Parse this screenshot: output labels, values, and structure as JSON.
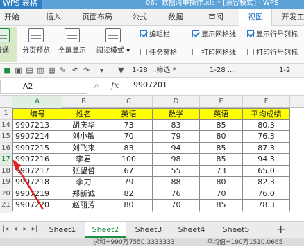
{
  "titlebar": {
    "app_name": "WPS 表格",
    "doc_title": "06：数据清单操作.xls * [兼容模式] - WPS"
  },
  "tabs": [
    {
      "label": "开始"
    },
    {
      "label": "插入"
    },
    {
      "label": "页面布局"
    },
    {
      "label": "公式"
    },
    {
      "label": "数据"
    },
    {
      "label": "审阅"
    },
    {
      "label": "视图"
    },
    {
      "label": "开发工"
    }
  ],
  "active_tab": "视图",
  "ribbon": {
    "buttons": [
      {
        "label": "普通",
        "icon": "normal-view-icon",
        "selected": true
      },
      {
        "label": "分页预览",
        "icon": "page-break-preview-icon",
        "selected": false
      },
      {
        "label": "全屏显示",
        "icon": "fullscreen-icon",
        "selected": false
      },
      {
        "label": "阅读模式 ▾",
        "icon": "reading-mode-icon",
        "selected": false
      }
    ],
    "checkboxes": [
      {
        "label": "编辑栏",
        "checked": true
      },
      {
        "label": "显示网格线",
        "checked": true
      },
      {
        "label": "显示行号列标",
        "checked": true
      },
      {
        "label": "任务窗格",
        "checked": false
      },
      {
        "label": "打印网格线",
        "checked": false
      },
      {
        "label": "打印行号列标",
        "checked": false
      }
    ]
  },
  "qat": {
    "doc_tab_1": "1-28 ...筛选 *",
    "doc_tab_2": "1-28 ...",
    "doc_tab_3": "1-2"
  },
  "formula_bar": {
    "name_box": "A2",
    "fx": "fx",
    "value": "9907201"
  },
  "columns": [
    "A",
    "B",
    "C",
    "D",
    "E",
    "F"
  ],
  "header_row": {
    "row_num": "1",
    "cells": [
      "编号",
      "姓名",
      "英语",
      "数学",
      "英语",
      "平均成绩"
    ]
  },
  "rows": [
    {
      "row_num": "14",
      "cells": [
        "9907213",
        "胡庆华",
        "73",
        "83",
        "85",
        "80.3"
      ]
    },
    {
      "row_num": "15",
      "cells": [
        "9907214",
        "刘小敏",
        "70",
        "79",
        "80",
        "76.3"
      ]
    },
    {
      "row_num": "16",
      "cells": [
        "9907215",
        "刘飞来",
        "83",
        "94",
        "85",
        "87.3"
      ]
    },
    {
      "row_num": "17",
      "cells": [
        "9907216",
        "李君",
        "100",
        "98",
        "85",
        "94.3"
      ]
    },
    {
      "row_num": "18",
      "cells": [
        "9907217",
        "张望哲",
        "67",
        "55",
        "73",
        "65.0"
      ]
    },
    {
      "row_num": "19",
      "cells": [
        "9907218",
        "李力",
        "79",
        "88",
        "80",
        "82.3"
      ]
    },
    {
      "row_num": "20",
      "cells": [
        "9907219",
        "郑新诚",
        "82",
        "76",
        "70",
        "76.0"
      ]
    },
    {
      "row_num": "21",
      "cells": [
        "9907220",
        "赵丽芳",
        "80",
        "70",
        "85",
        "78.3"
      ]
    },
    {
      "row_num": "22",
      "cells": [
        "",
        "",
        "",
        "",
        "",
        ""
      ]
    }
  ],
  "sheets": [
    "Sheet1",
    "Sheet2",
    "Sheet3",
    "Sheet4",
    "Sheet5"
  ],
  "active_sheet": "Sheet2",
  "status": {
    "sum": "求和=990万7550.3333333",
    "avg": "平均值=190万1510.0665"
  },
  "colors": {
    "header_fill": "#ffff00",
    "accent_green": "#1f8e45",
    "title_blue": "#2f7fc4",
    "arrow_red": "#e02020"
  }
}
